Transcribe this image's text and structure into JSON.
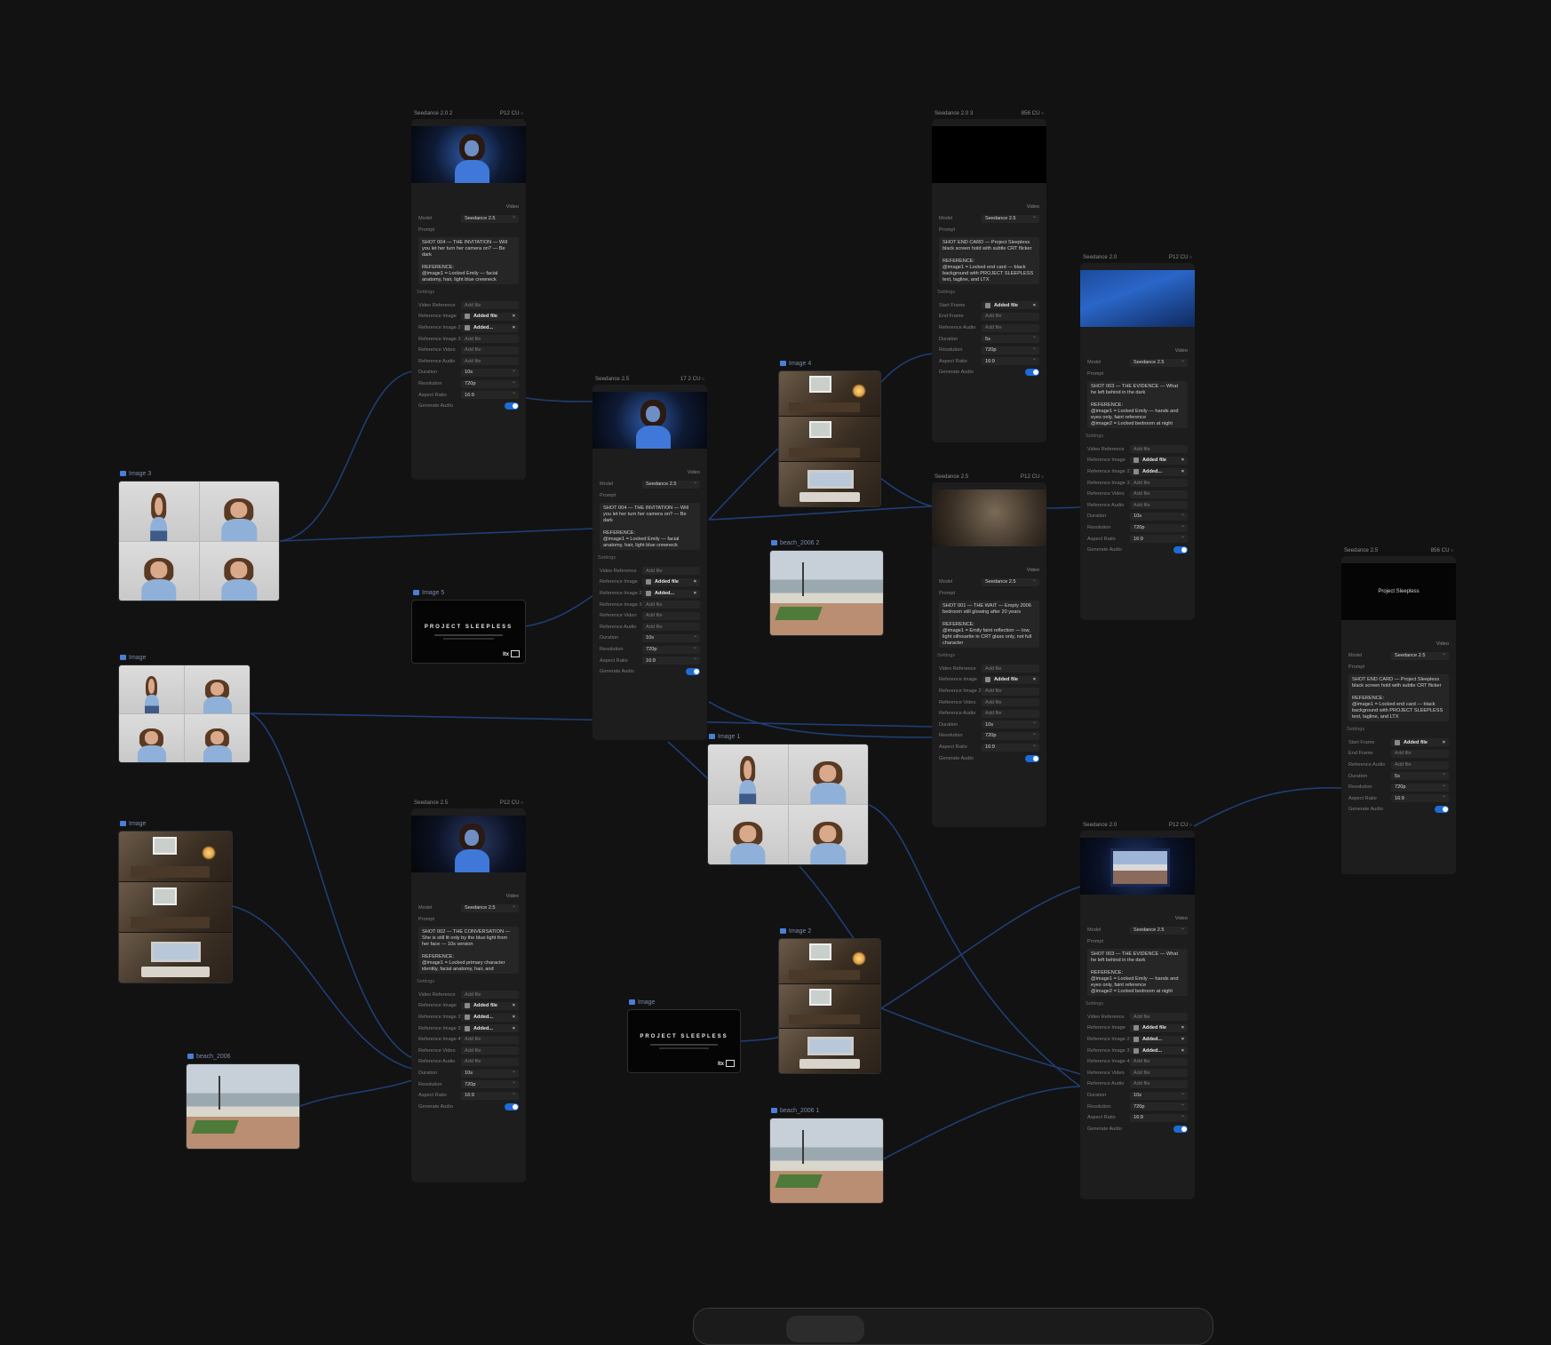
{
  "image_nodes": {
    "image3": {
      "caption": "Image 3"
    },
    "image_a": {
      "caption": "Image"
    },
    "image_room_left": {
      "caption": "Image"
    },
    "beach_left": {
      "caption": "beach_2006"
    },
    "image5": {
      "caption": "Image 5"
    },
    "image_poster_mid": {
      "caption": "Image"
    },
    "image4": {
      "caption": "Image 4"
    },
    "beach2": {
      "caption": "beach_2006 2"
    },
    "image1": {
      "caption": "Image 1"
    },
    "image2": {
      "caption": "Image 2"
    },
    "beach1": {
      "caption": "beach_2006 1"
    }
  },
  "poster": {
    "title": "PROJECT SLEEPLESS",
    "logo": "ltx"
  },
  "cards": {
    "c1": {
      "title": "Seedance 2.0 2",
      "credits": "P12 CU",
      "section": "Video",
      "model_label": "Model",
      "model": "Seedance 2.5",
      "prompt_label": "Prompt",
      "prompt": "SHOT 004 — THE INVITATION — Will you let her turn her camera on? — Be dark\n\nREFERENCE:\n@image1 = Locked Emily — facial anatomy, hair, light blue crewneck",
      "settings": "Settings",
      "rows": [
        {
          "label": "Video Reference",
          "value": "Add file"
        },
        {
          "label": "Reference Image",
          "value": "Added file"
        },
        {
          "label": "Reference Image 2",
          "value": "Added..."
        },
        {
          "label": "Reference Image 3",
          "value": "Add file"
        },
        {
          "label": "Reference Video",
          "value": "Add file"
        },
        {
          "label": "Reference Audio",
          "value": "Add file"
        },
        {
          "label": "Duration",
          "value": "10s"
        },
        {
          "label": "Resolution",
          "value": "720p"
        },
        {
          "label": "Aspect Ratio",
          "value": "16:9"
        },
        {
          "label": "Generate Audio",
          "value": ""
        }
      ]
    },
    "c2": {
      "title": "Seedance 2.5",
      "credits": "17 2 CU",
      "section": "Video",
      "model_label": "Model",
      "model": "Seedance 2.5",
      "prompt_label": "Prompt",
      "prompt": "SHOT 004 — THE INVITATION — Will you let her turn her camera on? — Be dark\n\nREFERENCE:\n@image1 = Locked Emily — facial anatomy, hair, light blue crewneck",
      "settings": "Settings",
      "rows": [
        {
          "label": "Video Reference",
          "value": "Add file"
        },
        {
          "label": "Reference Image",
          "value": "Added file"
        },
        {
          "label": "Reference Image 2",
          "value": "Added..."
        },
        {
          "label": "Reference Image 3",
          "value": "Add file"
        },
        {
          "label": "Reference Video",
          "value": "Add file"
        },
        {
          "label": "Reference Audio",
          "value": "Add file"
        },
        {
          "label": "Duration",
          "value": "10s"
        },
        {
          "label": "Resolution",
          "value": "720p"
        },
        {
          "label": "Aspect Ratio",
          "value": "16:9"
        },
        {
          "label": "Generate Audio",
          "value": ""
        }
      ]
    },
    "c3": {
      "title": "Seedance 2.5",
      "credits": "P12 CU",
      "section": "Video",
      "model_label": "Model",
      "model": "Seedance 2.5",
      "prompt_label": "Prompt",
      "prompt": "SHOT 002 — THE CONVERSATION — She is still lit only by the blue light from her face — 10s version\n\nREFERENCE:\n@image1 = Locked primary character identity, facial anatomy, hair, and",
      "settings": "Settings",
      "rows": [
        {
          "label": "Video Reference",
          "value": "Add file"
        },
        {
          "label": "Reference Image",
          "value": "Added file"
        },
        {
          "label": "Reference Image 2",
          "value": "Added..."
        },
        {
          "label": "Reference Image 3",
          "value": "Added..."
        },
        {
          "label": "Reference Image 4",
          "value": "Add file"
        },
        {
          "label": "Reference Video",
          "value": "Add file"
        },
        {
          "label": "Reference Audio",
          "value": "Add file"
        },
        {
          "label": "Duration",
          "value": "10s"
        },
        {
          "label": "Resolution",
          "value": "720p"
        },
        {
          "label": "Aspect Ratio",
          "value": "16:9"
        },
        {
          "label": "Generate Audio",
          "value": ""
        }
      ]
    },
    "c4": {
      "title": "Seedance 2.0 3",
      "credits": "856 CU",
      "section": "Video",
      "model_label": "Model",
      "model": "Seedance 2.5",
      "prompt_label": "Prompt",
      "prompt": "SHOT END CARD — Project Sleepless black screen hold with subtle CRT flicker\n\nREFERENCE:\n@image1 = Locked end card — black background with PROJECT SLEEPLESS text, tagline, and LTX",
      "settings": "Settings",
      "rows": [
        {
          "label": "Start Frame",
          "value": "Added file"
        },
        {
          "label": "End Frame",
          "value": "Add file"
        },
        {
          "label": "Reference Audio",
          "value": "Add file"
        },
        {
          "label": "Duration",
          "value": "5s"
        },
        {
          "label": "Resolution",
          "value": "720p"
        },
        {
          "label": "Aspect Ratio",
          "value": "16:9"
        },
        {
          "label": "Generate Audio",
          "value": ""
        }
      ]
    },
    "c5": {
      "title": "Seedance 2.5",
      "credits": "P12 CU",
      "section": "Video",
      "model_label": "Model",
      "model": "Seedance 2.5",
      "prompt_label": "Prompt",
      "prompt": "SHOT 001 — THE WAIT — Empty 2006 bedroom still glowing after 20 years\n\nREFERENCE:\n@image1 = Emily faint reflection — low, light silhouette in CRT glass only, not full character",
      "settings": "Settings",
      "rows": [
        {
          "label": "Video Reference",
          "value": "Add file"
        },
        {
          "label": "Reference Image",
          "value": "Added file"
        },
        {
          "label": "Reference Image 2",
          "value": "Add file"
        },
        {
          "label": "Reference Video",
          "value": "Add file"
        },
        {
          "label": "Reference Audio",
          "value": "Add file"
        },
        {
          "label": "Duration",
          "value": "10s"
        },
        {
          "label": "Resolution",
          "value": "720p"
        },
        {
          "label": "Aspect Ratio",
          "value": "16:9"
        },
        {
          "label": "Generate Audio",
          "value": ""
        }
      ]
    },
    "c6": {
      "title": "Seedance 2.0",
      "credits": "P12 CU",
      "section": "Video",
      "model_label": "Model",
      "model": "Seedance 2.5",
      "prompt_label": "Prompt",
      "prompt": "SHOT 003 — THE EVIDENCE — What he left behind in the dark\n\nREFERENCE:\n@image1 = Locked Emily — hands and eyes only, faint reference\n@image2 = Locked bedroom at night",
      "settings": "Settings",
      "rows": [
        {
          "label": "Video Reference",
          "value": "Add file"
        },
        {
          "label": "Reference Image",
          "value": "Added file"
        },
        {
          "label": "Reference Image 2",
          "value": "Added..."
        },
        {
          "label": "Reference Image 3",
          "value": "Add file"
        },
        {
          "label": "Reference Video",
          "value": "Add file"
        },
        {
          "label": "Reference Audio",
          "value": "Add file"
        },
        {
          "label": "Duration",
          "value": "10s"
        },
        {
          "label": "Resolution",
          "value": "720p"
        },
        {
          "label": "Aspect Ratio",
          "value": "16:9"
        },
        {
          "label": "Generate Audio",
          "value": ""
        }
      ]
    },
    "c7": {
      "title": "Seedance 2.0",
      "credits": "P12 CU",
      "section": "Video",
      "model_label": "Model",
      "model": "Seedance 2.5",
      "prompt_label": "Prompt",
      "prompt": "SHOT 003 — THE EVIDENCE — What he left behind in the dark\n\nREFERENCE:\n@image1 = Locked Emily — hands and eyes only, faint reference\n@image2 = Locked bedroom at night",
      "settings": "Settings",
      "rows": [
        {
          "label": "Video Reference",
          "value": "Add file"
        },
        {
          "label": "Reference Image",
          "value": "Added file"
        },
        {
          "label": "Reference Image 2",
          "value": "Added..."
        },
        {
          "label": "Reference Image 3",
          "value": "Added..."
        },
        {
          "label": "Reference Image 4",
          "value": "Add file"
        },
        {
          "label": "Reference Video",
          "value": "Add file"
        },
        {
          "label": "Reference Audio",
          "value": "Add file"
        },
        {
          "label": "Duration",
          "value": "10s"
        },
        {
          "label": "Resolution",
          "value": "720p"
        },
        {
          "label": "Aspect Ratio",
          "value": "16:9"
        },
        {
          "label": "Generate Audio",
          "value": ""
        }
      ]
    },
    "c8": {
      "title": "Seedance 2.5",
      "credits": "856 CU",
      "section": "Video",
      "model_label": "Model",
      "model": "Seedance 2.5",
      "prompt_label": "Prompt",
      "video_title": "Project Sleepless",
      "prompt": "SHOT END CARD — Project Sleepless black screen hold with subtle CRT flicker\n\nREFERENCE:\n@image1 = Locked end card — black background with PROJECT SLEEPLESS text, tagline, and LTX",
      "settings": "Settings",
      "rows": [
        {
          "label": "Start Frame",
          "value": "Added file"
        },
        {
          "label": "End Frame",
          "value": "Add file"
        },
        {
          "label": "Reference Audio",
          "value": "Add file"
        },
        {
          "label": "Duration",
          "value": "5s"
        },
        {
          "label": "Resolution",
          "value": "720p"
        },
        {
          "label": "Aspect Ratio",
          "value": "16:9"
        },
        {
          "label": "Generate Audio",
          "value": ""
        }
      ]
    }
  },
  "colors": {
    "canvas": "#121212",
    "wire": "#1f3e76",
    "toggle": "#1e6ad6"
  }
}
